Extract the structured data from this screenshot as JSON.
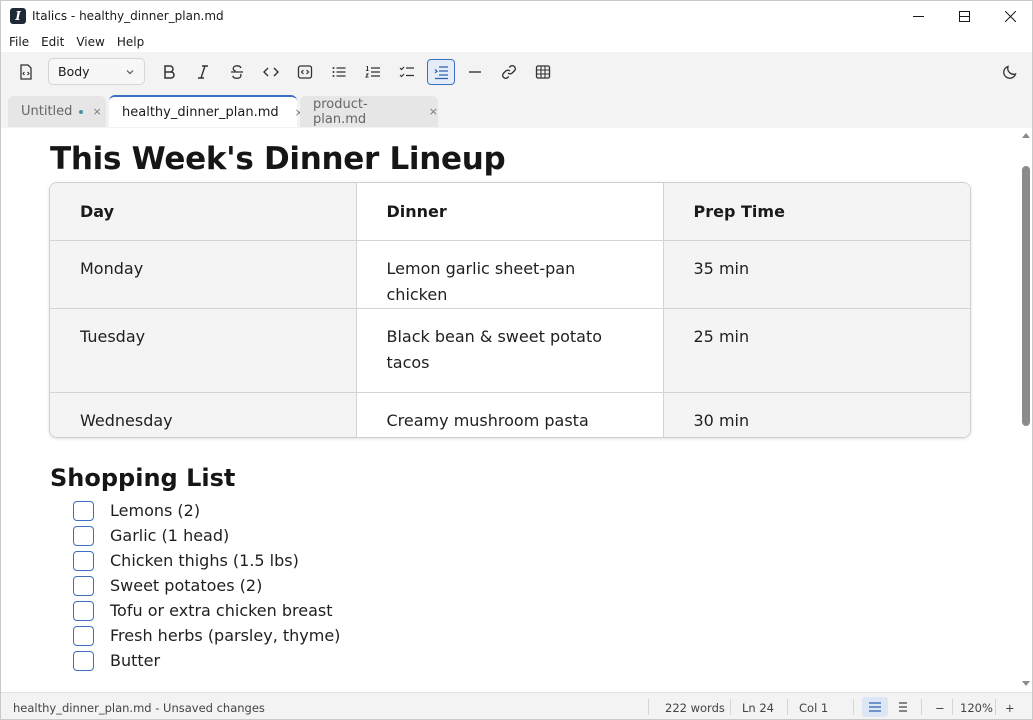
{
  "window": {
    "title": "Italics - healthy_dinner_plan.md",
    "logo_letter": "I",
    "minimize": "—",
    "maximize": "☐",
    "close": "✕"
  },
  "menu": [
    "File",
    "Edit",
    "View",
    "Help"
  ],
  "toolbar": {
    "style_value": "Body",
    "buttons": [
      "source-view",
      "bold",
      "italic",
      "strikethrough",
      "inline-code",
      "code-block",
      "bullet-list",
      "numbered-list",
      "task-list",
      "indent",
      "horizontal-rule",
      "link",
      "table",
      "dark-mode"
    ],
    "active_button": "indent"
  },
  "tabs": [
    {
      "label": "Untitled",
      "unsaved": true,
      "close": "×"
    },
    {
      "label": "healthy_dinner_plan.md",
      "unsaved": true,
      "close": "×",
      "active": true
    },
    {
      "label": "product-plan.md",
      "unsaved": false,
      "close": "×"
    }
  ],
  "document": {
    "heading1": "This Week's Dinner Lineup",
    "table": {
      "headers": [
        "Day",
        "Dinner",
        "Prep Time"
      ],
      "rows": [
        [
          "Monday",
          "Lemon garlic sheet-pan chicken",
          "35 min"
        ],
        [
          "Tuesday",
          "Black bean & sweet potato tacos",
          "25 min"
        ],
        [
          "Wednesday",
          "Creamy mushroom pasta",
          "30 min"
        ]
      ]
    },
    "heading2": "Shopping List",
    "checklist": [
      {
        "label": "Lemons (2)",
        "checked": false
      },
      {
        "label": "Garlic (1 head)",
        "checked": false
      },
      {
        "label": "Chicken thighs (1.5 lbs)",
        "checked": false
      },
      {
        "label": "Sweet potatoes (2)",
        "checked": false
      },
      {
        "label": "Tofu or extra chicken breast",
        "checked": false
      },
      {
        "label": "Fresh herbs (parsley, thyme)",
        "checked": false
      },
      {
        "label": "Butter",
        "checked": false
      }
    ]
  },
  "status": {
    "file_status": "healthy_dinner_plan.md - Unsaved changes",
    "words": "222 words",
    "line": "Ln 24",
    "col": "Col 1",
    "zoom": "120%",
    "zoom_out": "−",
    "zoom_in": "+"
  },
  "colors": {
    "accent": "#3b6fc4",
    "unsaved_dot": "#4a8e9c"
  }
}
